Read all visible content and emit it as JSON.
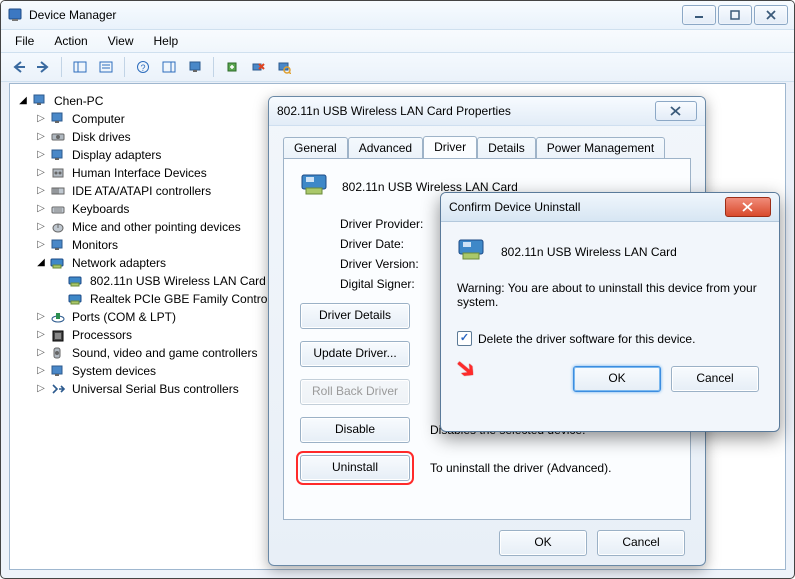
{
  "window": {
    "title": "Device Manager",
    "menus": [
      "File",
      "Action",
      "View",
      "Help"
    ]
  },
  "tree": {
    "root": "Chen-PC",
    "categories": [
      "Computer",
      "Disk drives",
      "Display adapters",
      "Human Interface Devices",
      "IDE ATA/ATAPI controllers",
      "Keyboards",
      "Mice and other pointing devices",
      "Monitors"
    ],
    "network_adapters_label": "Network adapters",
    "network_children": [
      "802.11n USB Wireless LAN Card",
      "Realtek PCIe GBE Family Controller"
    ],
    "categories_tail": [
      "Ports (COM & LPT)",
      "Processors",
      "Sound, video and game controllers",
      "System devices",
      "Universal Serial Bus controllers"
    ]
  },
  "props_dialog": {
    "title": "802.11n USB Wireless LAN Card Properties",
    "tabs": [
      "General",
      "Advanced",
      "Driver",
      "Details",
      "Power Management"
    ],
    "active_tab_index": 2,
    "device_name": "802.11n USB Wireless LAN Card",
    "labels": {
      "provider": "Driver Provider:",
      "date": "Driver Date:",
      "version": "Driver Version:",
      "signer": "Digital Signer:"
    },
    "buttons": {
      "details": "Driver Details",
      "update": "Update Driver...",
      "rollback": "Roll Back Driver",
      "disable": "Disable",
      "uninstall": "Uninstall"
    },
    "button_text": {
      "disable": "Disables the selected device.",
      "uninstall": "To uninstall the driver (Advanced)."
    },
    "ok": "OK",
    "cancel": "Cancel"
  },
  "confirm": {
    "title": "Confirm Device Uninstall",
    "device_name": "802.11n USB Wireless LAN Card",
    "warning": "Warning: You are about to uninstall this device from your system.",
    "checkbox_label": "Delete the driver software for this device.",
    "checkbox_checked": true,
    "ok": "OK",
    "cancel": "Cancel"
  }
}
